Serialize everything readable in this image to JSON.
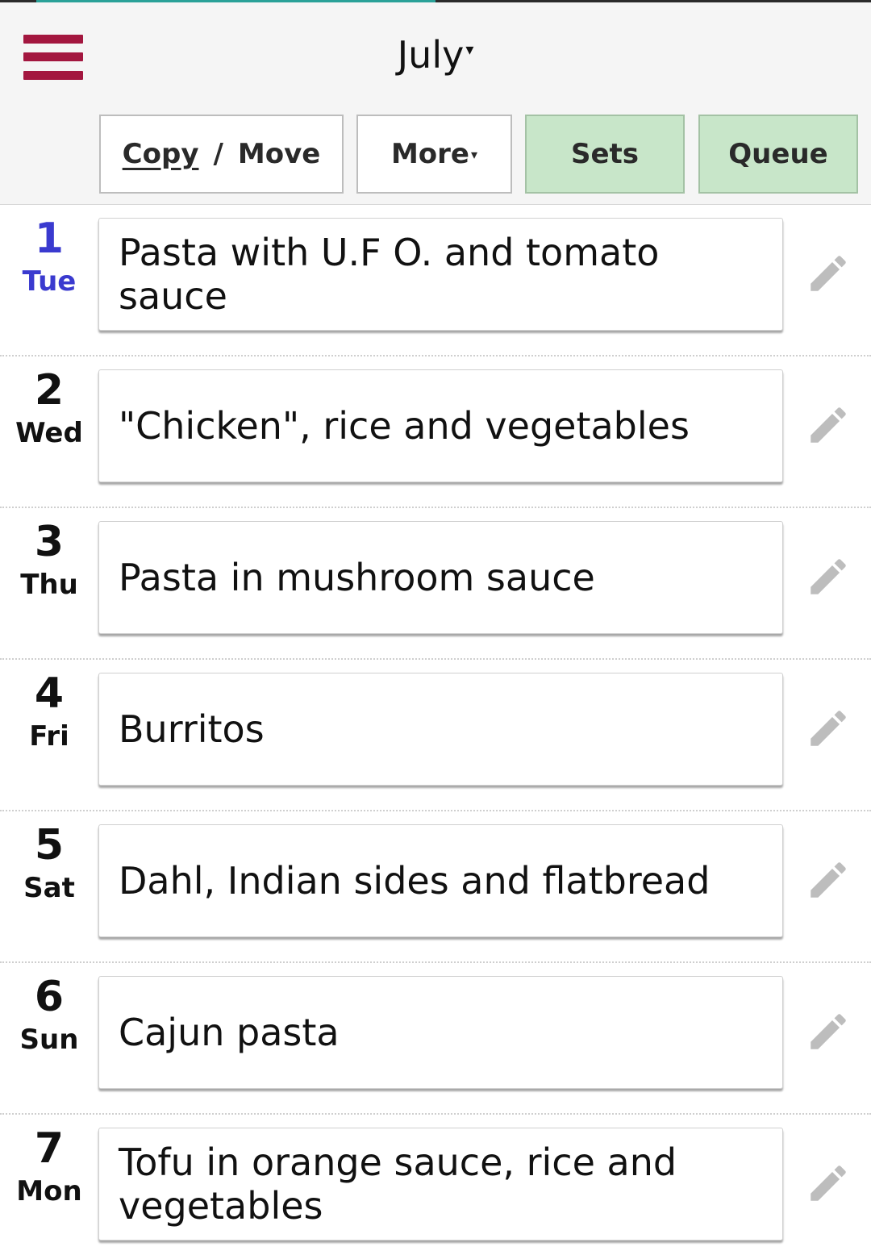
{
  "header": {
    "month": "July",
    "copy_label": "Copy",
    "slash": "/",
    "move_label": "Move",
    "more_label": "More",
    "sets_label": "Sets",
    "queue_label": "Queue"
  },
  "colors": {
    "menu": "#a3173f",
    "today": "#3a3acf",
    "sets_bg": "#c8e6c9",
    "queue_bg": "#c8e6c9",
    "progress": "#2aa198"
  },
  "icons": [
    "menu-icon",
    "caret-down-icon",
    "pencil-icon"
  ],
  "days": [
    {
      "num": "1",
      "name": "Tue",
      "meal": "Pasta with U.F O. and tomato sauce",
      "today": true
    },
    {
      "num": "2",
      "name": "Wed",
      "meal": "\"Chicken\", rice and vegetables"
    },
    {
      "num": "3",
      "name": "Thu",
      "meal": "Pasta in mushroom sauce"
    },
    {
      "num": "4",
      "name": "Fri",
      "meal": "Burritos"
    },
    {
      "num": "5",
      "name": "Sat",
      "meal": "Dahl, Indian sides and flatbread"
    },
    {
      "num": "6",
      "name": "Sun",
      "meal": "Cajun pasta"
    },
    {
      "num": "7",
      "name": "Mon",
      "meal": "Tofu in orange sauce, rice and vegetables"
    }
  ]
}
